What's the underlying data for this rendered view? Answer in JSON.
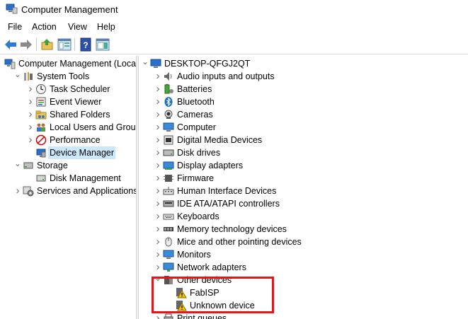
{
  "window": {
    "title": "Computer Management"
  },
  "menu": [
    "File",
    "Action",
    "View",
    "Help"
  ],
  "icons": {
    "back": "back-arrow-icon",
    "forward": "forward-arrow-icon",
    "up": "up-folder-icon",
    "console_tree": "console-tree-icon",
    "help": "help-icon",
    "properties": "properties-icon"
  },
  "left_tree": [
    {
      "label": "Computer Management (Local",
      "icon": "computer-management-icon",
      "chevron": "",
      "depth": 0
    },
    {
      "label": "System Tools",
      "icon": "tools-icon",
      "chevron": "expanded",
      "depth": 1
    },
    {
      "label": "Task Scheduler",
      "icon": "clock-icon",
      "chevron": "collapsed",
      "depth": 2
    },
    {
      "label": "Event Viewer",
      "icon": "event-viewer-icon",
      "chevron": "collapsed",
      "depth": 2
    },
    {
      "label": "Shared Folders",
      "icon": "shared-folder-icon",
      "chevron": "collapsed",
      "depth": 2
    },
    {
      "label": "Local Users and Groups",
      "icon": "users-icon",
      "chevron": "collapsed",
      "depth": 2
    },
    {
      "label": "Performance",
      "icon": "performance-icon",
      "chevron": "collapsed",
      "depth": 2
    },
    {
      "label": "Device Manager",
      "icon": "device-manager-icon",
      "chevron": "",
      "depth": 2,
      "selected": true
    },
    {
      "label": "Storage",
      "icon": "storage-icon",
      "chevron": "expanded",
      "depth": 1
    },
    {
      "label": "Disk Management",
      "icon": "disk-icon",
      "chevron": "",
      "depth": 2
    },
    {
      "label": "Services and Applications",
      "icon": "services-icon",
      "chevron": "collapsed",
      "depth": 1
    }
  ],
  "right_tree": {
    "root": {
      "label": "DESKTOP-QFGJ2QT",
      "icon": "computer-icon",
      "chevron": "expanded"
    },
    "categories": [
      {
        "label": "Audio inputs and outputs",
        "icon": "audio-icon",
        "chevron": "collapsed"
      },
      {
        "label": "Batteries",
        "icon": "battery-icon",
        "chevron": "collapsed"
      },
      {
        "label": "Bluetooth",
        "icon": "bluetooth-icon",
        "chevron": "collapsed"
      },
      {
        "label": "Cameras",
        "icon": "camera-icon",
        "chevron": "collapsed"
      },
      {
        "label": "Computer",
        "icon": "monitor-icon",
        "chevron": "collapsed"
      },
      {
        "label": "Digital Media Devices",
        "icon": "media-device-icon",
        "chevron": "collapsed"
      },
      {
        "label": "Disk drives",
        "icon": "disk-drive-icon",
        "chevron": "collapsed"
      },
      {
        "label": "Display adapters",
        "icon": "display-adapter-icon",
        "chevron": "collapsed"
      },
      {
        "label": "Firmware",
        "icon": "firmware-icon",
        "chevron": "collapsed"
      },
      {
        "label": "Human Interface Devices",
        "icon": "hid-icon",
        "chevron": "collapsed"
      },
      {
        "label": "IDE ATA/ATAPI controllers",
        "icon": "ide-controller-icon",
        "chevron": "collapsed"
      },
      {
        "label": "Keyboards",
        "icon": "keyboard-icon",
        "chevron": "collapsed"
      },
      {
        "label": "Memory technology devices",
        "icon": "memory-icon",
        "chevron": "collapsed"
      },
      {
        "label": "Mice and other pointing devices",
        "icon": "mouse-icon",
        "chevron": "collapsed"
      },
      {
        "label": "Monitors",
        "icon": "monitor-icon",
        "chevron": "collapsed"
      },
      {
        "label": "Network adapters",
        "icon": "network-adapter-icon",
        "chevron": "collapsed"
      },
      {
        "label": "Other devices",
        "icon": "other-devices-icon",
        "chevron": "expanded",
        "children": [
          {
            "label": "FabISP",
            "icon": "warning-device-icon"
          },
          {
            "label": "Unknown device",
            "icon": "warning-device-icon"
          }
        ]
      },
      {
        "label": "Print queues",
        "icon": "printer-icon",
        "chevron": "collapsed"
      }
    ]
  },
  "colors": {
    "selection": "#cce8ff",
    "highlight_box": "#e8141b"
  }
}
